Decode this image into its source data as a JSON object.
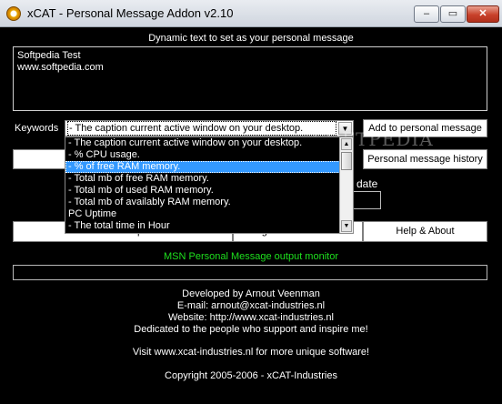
{
  "window": {
    "title": "xCAT - Personal Message Addon v2.10",
    "minimize_glyph": "‒",
    "maximize_glyph": "▭",
    "close_glyph": "✕"
  },
  "message": {
    "heading": "Dynamic text to set as your personal message",
    "lines": [
      "Softpedia Test",
      "www.softpedia.com"
    ]
  },
  "keywords": {
    "label": "Keywords",
    "selected": "- The caption current active window on your desktop.",
    "options": [
      "- The caption current active window on your desktop.",
      "- % CPU usage.",
      "- % of free RAM memory.",
      "- Total mb of free RAM memory.",
      "- Total mb of used RAM memory.",
      "- Total mb of availably RAM memory.",
      "PC Uptime",
      "- The total time in Hour"
    ],
    "highlighted_index": 2
  },
  "buttons": {
    "add": "Add to personal message",
    "history": "Personal message history",
    "help": "Help & About",
    "left_partial": "p",
    "mid_partial": "ettings"
  },
  "partial_text": {
    "update": "date"
  },
  "monitor": {
    "heading": "MSN Personal Message output monitor",
    "value": ""
  },
  "footer": {
    "line1": "Developed by Arnout Veenman",
    "line2": "E-mail: arnout@xcat-industries.nl",
    "line3": "Website: http://www.xcat-industries.nl",
    "line4": "Dedicated to the people who support and inspire me!",
    "line5": "Visit www.xcat-industries.nl for more unique software!",
    "line6": "Copyright 2005-2006 - xCAT-Industries"
  },
  "watermark": "SOFTPEDIA",
  "colors": {
    "background": "#000000",
    "monitor_heading": "#1ee01e",
    "selection": "#3399ff"
  }
}
